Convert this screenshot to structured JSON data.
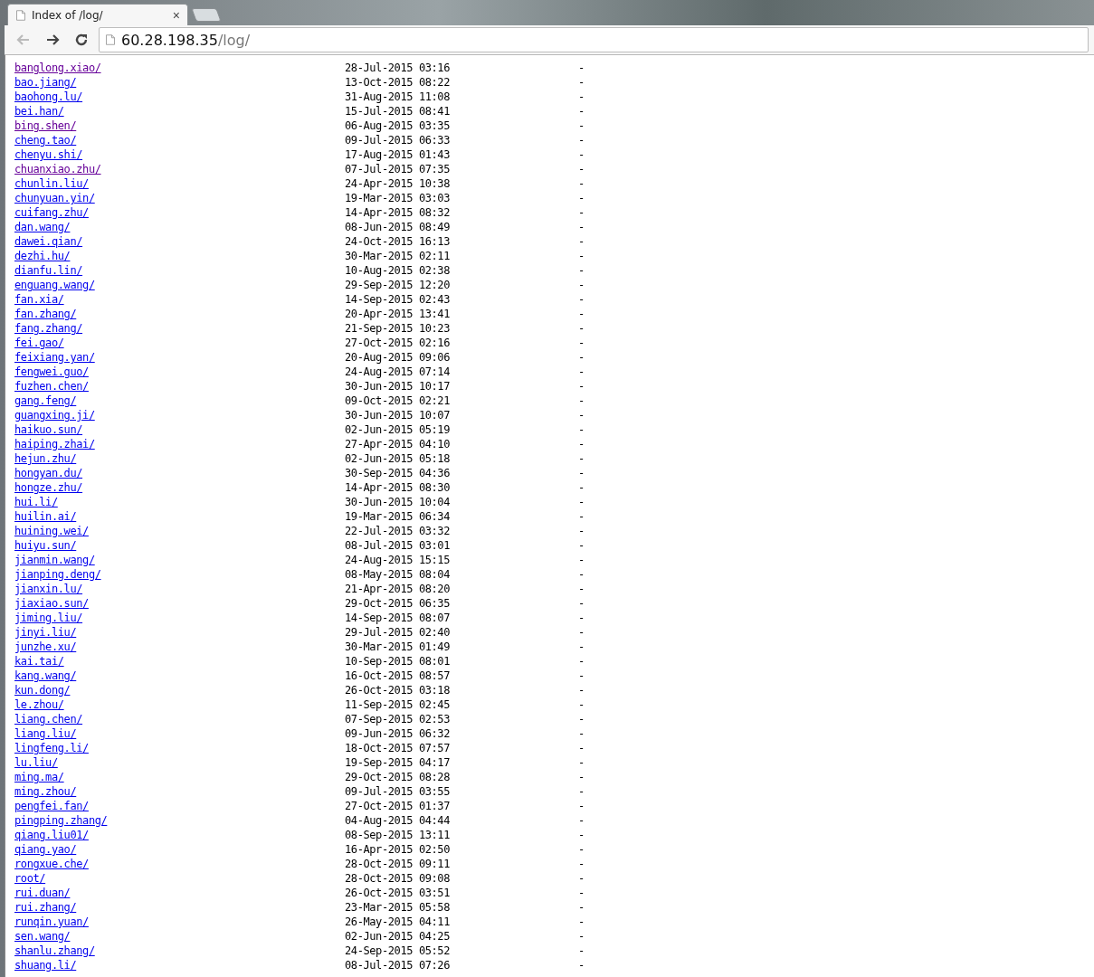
{
  "tab": {
    "title": "Index of /log/",
    "close": "×"
  },
  "address_bar": {
    "host": "60.28.198.35",
    "path": "/log/"
  },
  "listing": [
    {
      "name": "banglong.xiao/",
      "date": "28-Jul-2015 03:16",
      "size": "-",
      "visited": true
    },
    {
      "name": "bao.jiang/",
      "date": "13-Oct-2015 08:22",
      "size": "-",
      "visited": false
    },
    {
      "name": "baohong.lu/",
      "date": "31-Aug-2015 11:08",
      "size": "-",
      "visited": false
    },
    {
      "name": "bei.han/",
      "date": "15-Jul-2015 08:41",
      "size": "-",
      "visited": false
    },
    {
      "name": "bing.shen/",
      "date": "06-Aug-2015 03:35",
      "size": "-",
      "visited": true
    },
    {
      "name": "cheng.tao/",
      "date": "09-Jul-2015 06:33",
      "size": "-",
      "visited": false
    },
    {
      "name": "chenyu.shi/",
      "date": "17-Aug-2015 01:43",
      "size": "-",
      "visited": false
    },
    {
      "name": "chuanxiao.zhu/",
      "date": "07-Jul-2015 07:35",
      "size": "-",
      "visited": true
    },
    {
      "name": "chunlin.liu/",
      "date": "24-Apr-2015 10:38",
      "size": "-",
      "visited": false
    },
    {
      "name": "chunyuan.yin/",
      "date": "19-Mar-2015 03:03",
      "size": "-",
      "visited": false
    },
    {
      "name": "cuifang.zhu/",
      "date": "14-Apr-2015 08:32",
      "size": "-",
      "visited": false
    },
    {
      "name": "dan.wang/",
      "date": "08-Jun-2015 08:49",
      "size": "-",
      "visited": false
    },
    {
      "name": "dawei.qian/",
      "date": "24-Oct-2015 16:13",
      "size": "-",
      "visited": false
    },
    {
      "name": "dezhi.hu/",
      "date": "30-Mar-2015 02:11",
      "size": "-",
      "visited": false
    },
    {
      "name": "dianfu.lin/",
      "date": "10-Aug-2015 02:38",
      "size": "-",
      "visited": false
    },
    {
      "name": "enguang.wang/",
      "date": "29-Sep-2015 12:20",
      "size": "-",
      "visited": false
    },
    {
      "name": "fan.xia/",
      "date": "14-Sep-2015 02:43",
      "size": "-",
      "visited": false
    },
    {
      "name": "fan.zhang/",
      "date": "20-Apr-2015 13:41",
      "size": "-",
      "visited": false
    },
    {
      "name": "fang.zhang/",
      "date": "21-Sep-2015 10:23",
      "size": "-",
      "visited": false
    },
    {
      "name": "fei.gao/",
      "date": "27-Oct-2015 02:16",
      "size": "-",
      "visited": false
    },
    {
      "name": "feixiang.yan/",
      "date": "20-Aug-2015 09:06",
      "size": "-",
      "visited": false
    },
    {
      "name": "fengwei.guo/",
      "date": "24-Aug-2015 07:14",
      "size": "-",
      "visited": false
    },
    {
      "name": "fuzhen.chen/",
      "date": "30-Jun-2015 10:17",
      "size": "-",
      "visited": false
    },
    {
      "name": "gang.feng/",
      "date": "09-Oct-2015 02:21",
      "size": "-",
      "visited": false
    },
    {
      "name": "guangxing.ji/",
      "date": "30-Jun-2015 10:07",
      "size": "-",
      "visited": false
    },
    {
      "name": "haikuo.sun/",
      "date": "02-Jun-2015 05:19",
      "size": "-",
      "visited": false
    },
    {
      "name": "haiping.zhai/",
      "date": "27-Apr-2015 04:10",
      "size": "-",
      "visited": false
    },
    {
      "name": "hejun.zhu/",
      "date": "02-Jun-2015 05:18",
      "size": "-",
      "visited": false
    },
    {
      "name": "hongyan.du/",
      "date": "30-Sep-2015 04:36",
      "size": "-",
      "visited": false
    },
    {
      "name": "hongze.zhu/",
      "date": "14-Apr-2015 08:30",
      "size": "-",
      "visited": false
    },
    {
      "name": "hui.li/",
      "date": "30-Jun-2015 10:04",
      "size": "-",
      "visited": false
    },
    {
      "name": "huilin.ai/",
      "date": "19-Mar-2015 06:34",
      "size": "-",
      "visited": false
    },
    {
      "name": "huining.wei/",
      "date": "22-Jul-2015 03:32",
      "size": "-",
      "visited": false
    },
    {
      "name": "huiyu.sun/",
      "date": "08-Jul-2015 03:01",
      "size": "-",
      "visited": false
    },
    {
      "name": "jianmin.wang/",
      "date": "24-Aug-2015 15:15",
      "size": "-",
      "visited": false
    },
    {
      "name": "jianping.deng/",
      "date": "08-May-2015 08:04",
      "size": "-",
      "visited": false
    },
    {
      "name": "jianxin.lu/",
      "date": "21-Apr-2015 08:20",
      "size": "-",
      "visited": false
    },
    {
      "name": "jiaxiao.sun/",
      "date": "29-Oct-2015 06:35",
      "size": "-",
      "visited": false
    },
    {
      "name": "jiming.liu/",
      "date": "14-Sep-2015 08:07",
      "size": "-",
      "visited": false
    },
    {
      "name": "jinyi.liu/",
      "date": "29-Jul-2015 02:40",
      "size": "-",
      "visited": false
    },
    {
      "name": "junzhe.xu/",
      "date": "30-Mar-2015 01:49",
      "size": "-",
      "visited": false
    },
    {
      "name": "kai.tai/",
      "date": "10-Sep-2015 08:01",
      "size": "-",
      "visited": false
    },
    {
      "name": "kang.wang/",
      "date": "16-Oct-2015 08:57",
      "size": "-",
      "visited": false
    },
    {
      "name": "kun.dong/",
      "date": "26-Oct-2015 03:18",
      "size": "-",
      "visited": false
    },
    {
      "name": "le.zhou/",
      "date": "11-Sep-2015 02:45",
      "size": "-",
      "visited": false
    },
    {
      "name": "liang.chen/",
      "date": "07-Sep-2015 02:53",
      "size": "-",
      "visited": false
    },
    {
      "name": "liang.liu/",
      "date": "09-Jun-2015 06:32",
      "size": "-",
      "visited": false
    },
    {
      "name": "lingfeng.li/",
      "date": "18-Oct-2015 07:57",
      "size": "-",
      "visited": false
    },
    {
      "name": "lu.liu/",
      "date": "19-Sep-2015 04:17",
      "size": "-",
      "visited": false
    },
    {
      "name": "ming.ma/",
      "date": "29-Oct-2015 08:28",
      "size": "-",
      "visited": false
    },
    {
      "name": "ming.zhou/",
      "date": "09-Jul-2015 03:55",
      "size": "-",
      "visited": false
    },
    {
      "name": "pengfei.fan/",
      "date": "27-Oct-2015 01:37",
      "size": "-",
      "visited": false
    },
    {
      "name": "pingping.zhang/",
      "date": "04-Aug-2015 04:44",
      "size": "-",
      "visited": false
    },
    {
      "name": "qiang.liu01/",
      "date": "08-Sep-2015 13:11",
      "size": "-",
      "visited": false
    },
    {
      "name": "qiang.yao/",
      "date": "16-Apr-2015 02:50",
      "size": "-",
      "visited": false
    },
    {
      "name": "rongxue.che/",
      "date": "28-Oct-2015 09:11",
      "size": "-",
      "visited": false
    },
    {
      "name": "root/",
      "date": "28-Oct-2015 09:08",
      "size": "-",
      "visited": false
    },
    {
      "name": "rui.duan/",
      "date": "26-Oct-2015 03:51",
      "size": "-",
      "visited": false
    },
    {
      "name": "rui.zhang/",
      "date": "23-Mar-2015 05:58",
      "size": "-",
      "visited": false
    },
    {
      "name": "runqin.yuan/",
      "date": "26-May-2015 04:11",
      "size": "-",
      "visited": false
    },
    {
      "name": "sen.wang/",
      "date": "02-Jun-2015 04:25",
      "size": "-",
      "visited": false
    },
    {
      "name": "shanlu.zhang/",
      "date": "24-Sep-2015 05:52",
      "size": "-",
      "visited": false
    },
    {
      "name": "shuang.li/",
      "date": "08-Jul-2015 07:26",
      "size": "-",
      "visited": false
    }
  ]
}
